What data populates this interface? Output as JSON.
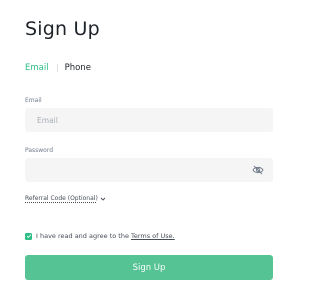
{
  "page": {
    "title": "Sign Up"
  },
  "tabs": [
    {
      "label": "Email",
      "active": true
    },
    {
      "label": "Phone",
      "active": false
    }
  ],
  "email": {
    "label": "Email",
    "placeholder": "Email",
    "value": ""
  },
  "password": {
    "label": "Password",
    "placeholder": "",
    "value": "",
    "toggle_icon": "eye-hidden-icon"
  },
  "referral": {
    "label": "Referral Code (Optional)",
    "icon": "chevron-down-icon"
  },
  "agreement": {
    "checked": true,
    "text": "I have read and agree to the",
    "link": "Terms of Use."
  },
  "submit": {
    "label": "Sign Up"
  },
  "colors": {
    "accent": "#2ebd85",
    "button": "#55c393",
    "field_bg": "#f5f5f5"
  }
}
